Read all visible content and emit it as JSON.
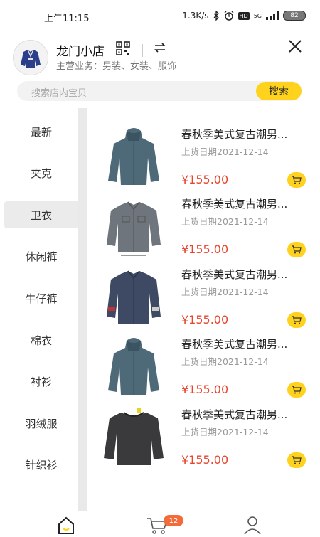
{
  "status_bar": {
    "time": "上午11:15",
    "network_speed": "1.3K/s",
    "hd_label": "HD",
    "net_type": "5G",
    "battery": "82"
  },
  "store": {
    "name": "龙门小店",
    "business": "主营业务：男装、女装、服饰"
  },
  "search": {
    "placeholder": "搜索店内宝贝",
    "button_label": "搜索"
  },
  "categories": [
    "最新",
    "夹克",
    "卫衣",
    "休闲裤",
    "牛仔裤",
    "棉衣",
    "衬衫",
    "羽绒服",
    "针织衫"
  ],
  "active_category": "卫衣",
  "products": [
    {
      "title": "春秋季美式复古潮男...",
      "date": "上货日期2021-12-14",
      "price": "¥155.00",
      "image": "teal-hoodie"
    },
    {
      "title": "春秋季美式复古潮男...",
      "date": "上货日期2021-12-14",
      "price": "¥155.00",
      "image": "grey-denim-jacket"
    },
    {
      "title": "春秋季美式复古潮男...",
      "date": "上货日期2021-12-14",
      "price": "¥155.00",
      "image": "navy-shirt-jacket"
    },
    {
      "title": "春秋季美式复古潮男...",
      "date": "上货日期2021-12-14",
      "price": "¥155.00",
      "image": "teal-hoodie"
    },
    {
      "title": "春秋季美式复古潮男...",
      "date": "上货日期2021-12-14",
      "price": "¥155.00",
      "image": "black-sweater"
    }
  ],
  "tabbar": {
    "cart_badge": "12",
    "tabs": [
      "home-icon",
      "cart-icon",
      "user-icon"
    ]
  },
  "colors": {
    "accent_yellow": "#ffd21d",
    "price_red": "#e8452c",
    "badge_orange": "#f26b3a"
  }
}
